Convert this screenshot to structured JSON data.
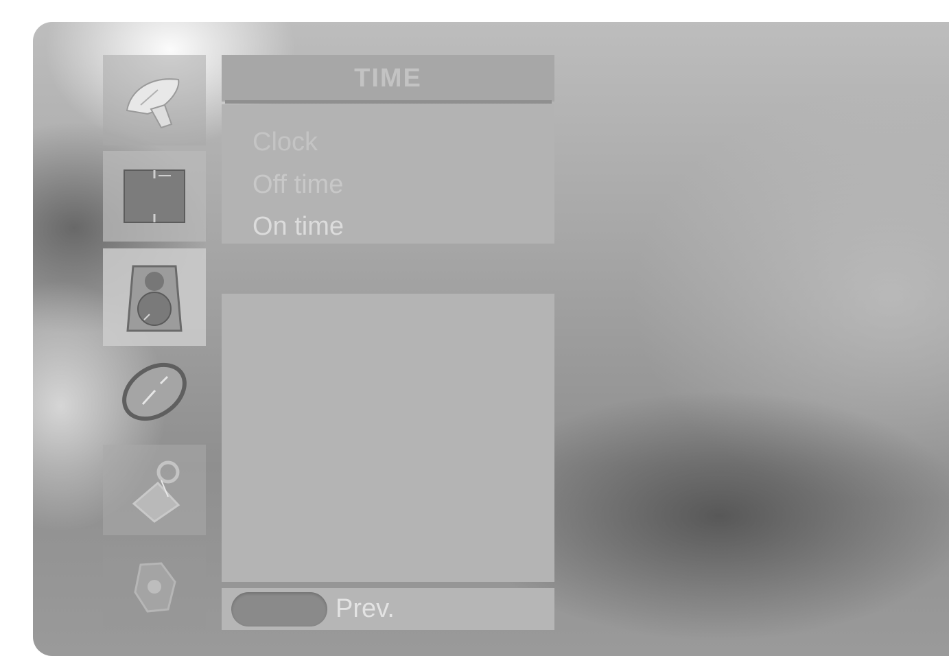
{
  "menu": {
    "title": "TIME",
    "items": [
      {
        "label": "Clock"
      },
      {
        "label": "Off time"
      },
      {
        "label": "On time"
      }
    ]
  },
  "footer": {
    "prev_label": "Prev."
  },
  "side_icons": [
    {
      "icon": "satellite-dish-icon"
    },
    {
      "icon": "picture-screen-icon"
    },
    {
      "icon": "speaker-icon"
    },
    {
      "icon": "clock-icon"
    },
    {
      "icon": "lock-icon"
    },
    {
      "icon": "setup-icon"
    }
  ],
  "colors": {
    "panel": "#b4b4b4",
    "title_bar": "#a7a7a7",
    "prev_button": "#8a8a8a"
  }
}
